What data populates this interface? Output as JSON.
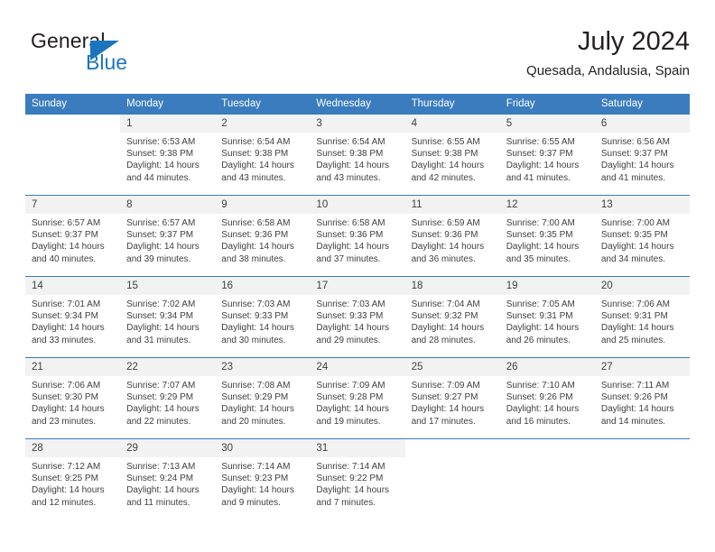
{
  "brand": {
    "name_part1": "General",
    "name_part2": "Blue",
    "accent_color": "#1b75bc",
    "triangle_icon": "play-triangle-icon"
  },
  "header": {
    "title": "July 2024",
    "subtitle": "Quesada, Andalusia, Spain"
  },
  "theme": {
    "header_row_color": "#3a7cbe",
    "day_number_bg": "#f2f2f2",
    "text_color": "#404040"
  },
  "weekdays": [
    "Sunday",
    "Monday",
    "Tuesday",
    "Wednesday",
    "Thursday",
    "Friday",
    "Saturday"
  ],
  "weeks": [
    [
      {
        "day": "",
        "lines": []
      },
      {
        "day": "1",
        "lines": [
          "Sunrise: 6:53 AM",
          "Sunset: 9:38 PM",
          "Daylight: 14 hours",
          "and 44 minutes."
        ]
      },
      {
        "day": "2",
        "lines": [
          "Sunrise: 6:54 AM",
          "Sunset: 9:38 PM",
          "Daylight: 14 hours",
          "and 43 minutes."
        ]
      },
      {
        "day": "3",
        "lines": [
          "Sunrise: 6:54 AM",
          "Sunset: 9:38 PM",
          "Daylight: 14 hours",
          "and 43 minutes."
        ]
      },
      {
        "day": "4",
        "lines": [
          "Sunrise: 6:55 AM",
          "Sunset: 9:38 PM",
          "Daylight: 14 hours",
          "and 42 minutes."
        ]
      },
      {
        "day": "5",
        "lines": [
          "Sunrise: 6:55 AM",
          "Sunset: 9:37 PM",
          "Daylight: 14 hours",
          "and 41 minutes."
        ]
      },
      {
        "day": "6",
        "lines": [
          "Sunrise: 6:56 AM",
          "Sunset: 9:37 PM",
          "Daylight: 14 hours",
          "and 41 minutes."
        ]
      }
    ],
    [
      {
        "day": "7",
        "lines": [
          "Sunrise: 6:57 AM",
          "Sunset: 9:37 PM",
          "Daylight: 14 hours",
          "and 40 minutes."
        ]
      },
      {
        "day": "8",
        "lines": [
          "Sunrise: 6:57 AM",
          "Sunset: 9:37 PM",
          "Daylight: 14 hours",
          "and 39 minutes."
        ]
      },
      {
        "day": "9",
        "lines": [
          "Sunrise: 6:58 AM",
          "Sunset: 9:36 PM",
          "Daylight: 14 hours",
          "and 38 minutes."
        ]
      },
      {
        "day": "10",
        "lines": [
          "Sunrise: 6:58 AM",
          "Sunset: 9:36 PM",
          "Daylight: 14 hours",
          "and 37 minutes."
        ]
      },
      {
        "day": "11",
        "lines": [
          "Sunrise: 6:59 AM",
          "Sunset: 9:36 PM",
          "Daylight: 14 hours",
          "and 36 minutes."
        ]
      },
      {
        "day": "12",
        "lines": [
          "Sunrise: 7:00 AM",
          "Sunset: 9:35 PM",
          "Daylight: 14 hours",
          "and 35 minutes."
        ]
      },
      {
        "day": "13",
        "lines": [
          "Sunrise: 7:00 AM",
          "Sunset: 9:35 PM",
          "Daylight: 14 hours",
          "and 34 minutes."
        ]
      }
    ],
    [
      {
        "day": "14",
        "lines": [
          "Sunrise: 7:01 AM",
          "Sunset: 9:34 PM",
          "Daylight: 14 hours",
          "and 33 minutes."
        ]
      },
      {
        "day": "15",
        "lines": [
          "Sunrise: 7:02 AM",
          "Sunset: 9:34 PM",
          "Daylight: 14 hours",
          "and 31 minutes."
        ]
      },
      {
        "day": "16",
        "lines": [
          "Sunrise: 7:03 AM",
          "Sunset: 9:33 PM",
          "Daylight: 14 hours",
          "and 30 minutes."
        ]
      },
      {
        "day": "17",
        "lines": [
          "Sunrise: 7:03 AM",
          "Sunset: 9:33 PM",
          "Daylight: 14 hours",
          "and 29 minutes."
        ]
      },
      {
        "day": "18",
        "lines": [
          "Sunrise: 7:04 AM",
          "Sunset: 9:32 PM",
          "Daylight: 14 hours",
          "and 28 minutes."
        ]
      },
      {
        "day": "19",
        "lines": [
          "Sunrise: 7:05 AM",
          "Sunset: 9:31 PM",
          "Daylight: 14 hours",
          "and 26 minutes."
        ]
      },
      {
        "day": "20",
        "lines": [
          "Sunrise: 7:06 AM",
          "Sunset: 9:31 PM",
          "Daylight: 14 hours",
          "and 25 minutes."
        ]
      }
    ],
    [
      {
        "day": "21",
        "lines": [
          "Sunrise: 7:06 AM",
          "Sunset: 9:30 PM",
          "Daylight: 14 hours",
          "and 23 minutes."
        ]
      },
      {
        "day": "22",
        "lines": [
          "Sunrise: 7:07 AM",
          "Sunset: 9:29 PM",
          "Daylight: 14 hours",
          "and 22 minutes."
        ]
      },
      {
        "day": "23",
        "lines": [
          "Sunrise: 7:08 AM",
          "Sunset: 9:29 PM",
          "Daylight: 14 hours",
          "and 20 minutes."
        ]
      },
      {
        "day": "24",
        "lines": [
          "Sunrise: 7:09 AM",
          "Sunset: 9:28 PM",
          "Daylight: 14 hours",
          "and 19 minutes."
        ]
      },
      {
        "day": "25",
        "lines": [
          "Sunrise: 7:09 AM",
          "Sunset: 9:27 PM",
          "Daylight: 14 hours",
          "and 17 minutes."
        ]
      },
      {
        "day": "26",
        "lines": [
          "Sunrise: 7:10 AM",
          "Sunset: 9:26 PM",
          "Daylight: 14 hours",
          "and 16 minutes."
        ]
      },
      {
        "day": "27",
        "lines": [
          "Sunrise: 7:11 AM",
          "Sunset: 9:26 PM",
          "Daylight: 14 hours",
          "and 14 minutes."
        ]
      }
    ],
    [
      {
        "day": "28",
        "lines": [
          "Sunrise: 7:12 AM",
          "Sunset: 9:25 PM",
          "Daylight: 14 hours",
          "and 12 minutes."
        ]
      },
      {
        "day": "29",
        "lines": [
          "Sunrise: 7:13 AM",
          "Sunset: 9:24 PM",
          "Daylight: 14 hours",
          "and 11 minutes."
        ]
      },
      {
        "day": "30",
        "lines": [
          "Sunrise: 7:14 AM",
          "Sunset: 9:23 PM",
          "Daylight: 14 hours",
          "and 9 minutes."
        ]
      },
      {
        "day": "31",
        "lines": [
          "Sunrise: 7:14 AM",
          "Sunset: 9:22 PM",
          "Daylight: 14 hours",
          "and 7 minutes."
        ]
      },
      {
        "day": "",
        "lines": []
      },
      {
        "day": "",
        "lines": []
      },
      {
        "day": "",
        "lines": []
      }
    ]
  ]
}
